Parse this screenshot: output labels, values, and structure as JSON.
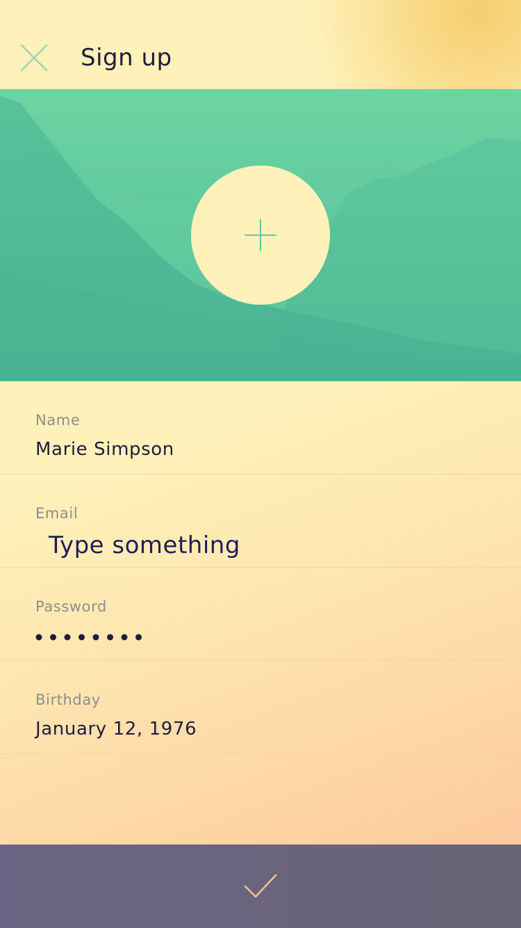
{
  "header": {
    "title": "Sign up",
    "close_icon": "close-icon"
  },
  "hero": {
    "add_photo_icon": "plus-icon"
  },
  "form": {
    "name": {
      "label": "Name",
      "value": "Marie Simpson"
    },
    "email": {
      "label": "Email",
      "placeholder": "Type something",
      "value": ""
    },
    "password": {
      "label": "Password",
      "masked_length": 8
    },
    "birthday": {
      "label": "Birthday",
      "value": "January 12, 1976"
    }
  },
  "submit": {
    "icon": "checkmark-icon"
  },
  "colors": {
    "accent_green": "#5fcc9c",
    "cream": "#fef1b9",
    "peach": "#fcc39b",
    "text_dark": "#1f1d3c",
    "label_gray": "#8e8c92",
    "submit_bar": "#686476",
    "check_stroke": "#f6c38a"
  }
}
